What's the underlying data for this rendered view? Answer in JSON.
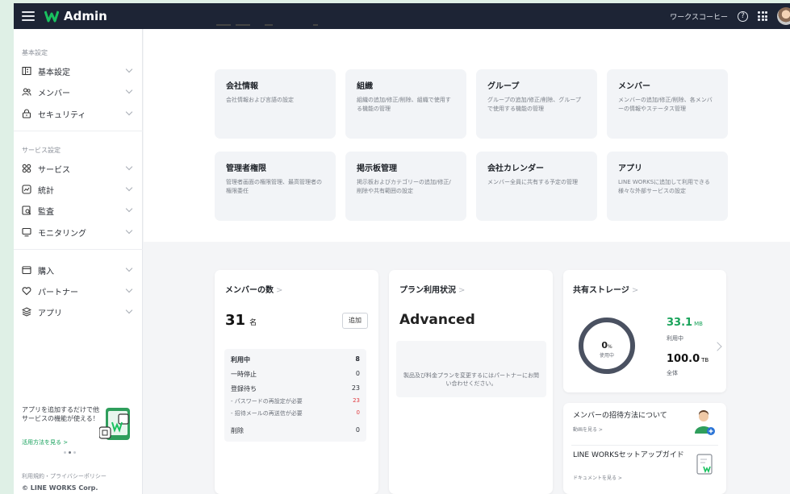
{
  "header": {
    "app_title": "Admin",
    "company_name": "ワークスコーヒー",
    "help_glyph": "?",
    "icons": [
      "menu-icon",
      "works-logo-icon",
      "help-icon",
      "app-grid-icon",
      "avatar"
    ]
  },
  "sidebar": {
    "section_basic": "基本設定",
    "section_service": "サービス設定",
    "items": [
      {
        "label": "基本設定",
        "icon": "building-icon"
      },
      {
        "label": "メンバー",
        "icon": "members-icon"
      },
      {
        "label": "セキュリティ",
        "icon": "lock-icon"
      },
      {
        "label": "サービス",
        "icon": "service-icon"
      },
      {
        "label": "統計",
        "icon": "stats-icon"
      },
      {
        "label": "監査",
        "icon": "audit-icon"
      },
      {
        "label": "モニタリング",
        "icon": "monitor-icon"
      },
      {
        "label": "購入",
        "icon": "purchase-icon"
      },
      {
        "label": "パートナー",
        "icon": "partner-icon"
      },
      {
        "label": "アプリ",
        "icon": "app-icon"
      }
    ],
    "promo_text": "アプリを追加するだけで他サービスの機能が使える！",
    "promo_link": "活用方法を見る >",
    "terms": "利用規約・プライバシーポリシー",
    "copyright": "© LINE WORKS Corp."
  },
  "features": [
    {
      "title": "会社情報",
      "desc": "会社情報および言語の設定"
    },
    {
      "title": "組織",
      "desc": "組織の追加/修正/削除、組織で使用する機能の管理"
    },
    {
      "title": "グループ",
      "desc": "グループの追加/修正/削除、グループで使用する機能の管理"
    },
    {
      "title": "メンバー",
      "desc": "メンバーの追加/修正/削除、各メンバーの情報やステータス管理"
    },
    {
      "title": "管理者権限",
      "desc": "管理者画面の権限管理、最高管理者の権限委任"
    },
    {
      "title": "掲示板管理",
      "desc": "掲示板およびカテゴリーの追加/修正/削除や共有範囲の設定"
    },
    {
      "title": "会社カレンダー",
      "desc": "メンバー全員に共有する予定の管理"
    },
    {
      "title": "アプリ",
      "desc": "LINE WORKSに追加して利用できる様々な外部サービスの設定"
    }
  ],
  "members": {
    "title": "メンバーの数",
    "arrow": ">",
    "count": "31",
    "unit": "名",
    "add_button": "追加",
    "stats": [
      {
        "label": "利用中",
        "value": "8"
      },
      {
        "label": "一時停止",
        "value": "0"
      },
      {
        "label": "登録待ち",
        "value": "23"
      },
      {
        "label": "- パスワードの再設定が必要",
        "value": "23"
      },
      {
        "label": "- 招待メールの再送信が必要",
        "value": "0"
      },
      {
        "label": "削除",
        "value": "0"
      }
    ]
  },
  "plan": {
    "title": "プラン利用状況",
    "arrow": ">",
    "name": "Advanced",
    "note": "製品及び料金プランを変更するにはパートナーにお問い合わせください。"
  },
  "storage": {
    "title": "共有ストレージ",
    "arrow": ">",
    "percent": "0",
    "percent_unit": "%",
    "percent_label": "使用中",
    "used_value": "33.1",
    "used_unit": "MB",
    "used_label": "利用中",
    "total_value": "100.0",
    "total_unit": "TB",
    "total_label": "全体",
    "usage_fraction": 0.0,
    "ring_color": "#4a5161"
  },
  "guides": [
    {
      "title": "メンバーの招待方法について",
      "link": "動画を見る >",
      "icon": "invite-member-icon"
    },
    {
      "title": "LINE WORKSセットアップガイド",
      "link": "ドキュメントを見る >",
      "icon": "document-icon"
    }
  ],
  "colors": {
    "topbar": "#1d2435",
    "accent_green": "#18a35a",
    "warning_red": "#e0393e"
  }
}
